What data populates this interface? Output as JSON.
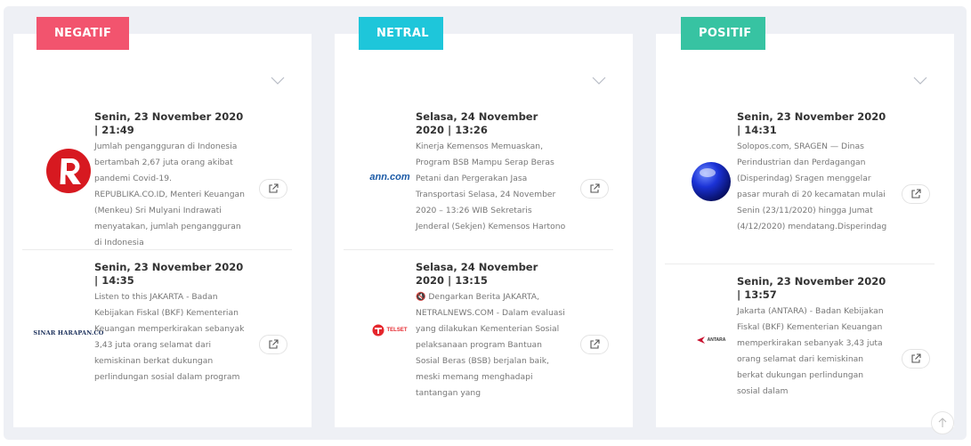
{
  "columns": [
    {
      "label": "NEGATIF",
      "items": [
        {
          "date": "Senin, 23 November 2020 | 21:49",
          "desc": "Jumlah pengangguran di Indonesia bertambah 2,67 juta orang akibat pandemi Covid-19. REPUBLIKA.CO.ID, Menteri Keuangan (Menkeu) Sri Mulyani Indrawati menyatakan, jumlah pengangguran di Indonesia",
          "logo": "republika-logo"
        },
        {
          "date": "Senin, 23 November 2020 | 14:35",
          "desc": "Listen to this JAKARTA - Badan Kebijakan Fiskal (BKF) Kementerian Keuangan memperkirakan sebanyak 3,43 juta orang selamat dari kemiskinan berkat dukungan perlindungan sosial dalam program",
          "logo_text": "SINAR HARAPAN.CO"
        }
      ]
    },
    {
      "label": "NETRAL",
      "items": [
        {
          "date": "Selasa, 24 November 2020 | 13:26",
          "desc": "Kinerja Kemensos Memuaskan, Program BSB Mampu Serap Beras Petani dan Pergerakan Jasa Transportasi Selasa, 24 November 2020 – 13:26 WIB Sekretaris Jenderal (Sekjen) Kemensos Hartono",
          "logo_text": "ann.com"
        },
        {
          "date": "Selasa, 24 November 2020 | 13:15",
          "desc": "🔇 Dengarkan Berita JAKARTA, NETRALNEWS.COM - Dalam evaluasi yang dilakukan Kementerian Sosial pelaksanaan program Bantuan Sosial Beras (BSB) berjalan baik, meski memang menghadapi tantangan yang",
          "logo_text": "TELSET"
        }
      ]
    },
    {
      "label": "POSITIF",
      "items": [
        {
          "date": "Senin, 23 November 2020 | 14:31",
          "desc": "Solopos.com, SRAGEN — Dinas Perindustrian dan Perdagangan (Disperindag) Sragen menggelar pasar murah di 20 kecamatan mulai Senin (23/11/2020) hingga Jumat (4/12/2020) mendatang.Disperindag",
          "logo": "blue-sphere-logo"
        },
        {
          "date": "Senin, 23 November 2020 | 13:57",
          "desc": "Jakarta (ANTARA) - Badan Kebijakan Fiskal (BKF) Kementerian Keuangan memperkirakan sebanyak 3,43 juta orang selamat dari kemiskinan berkat dukungan perlindungan sosial dalam",
          "logo_text": "ANTARA"
        }
      ]
    }
  ],
  "colors": {
    "negatif": "#f2546e",
    "netral": "#1ec6da",
    "positif": "#37c3a2"
  },
  "icons": {
    "expand": "chevron-down-icon",
    "external": "external-link-icon",
    "scroll": "arrow-up-icon"
  }
}
